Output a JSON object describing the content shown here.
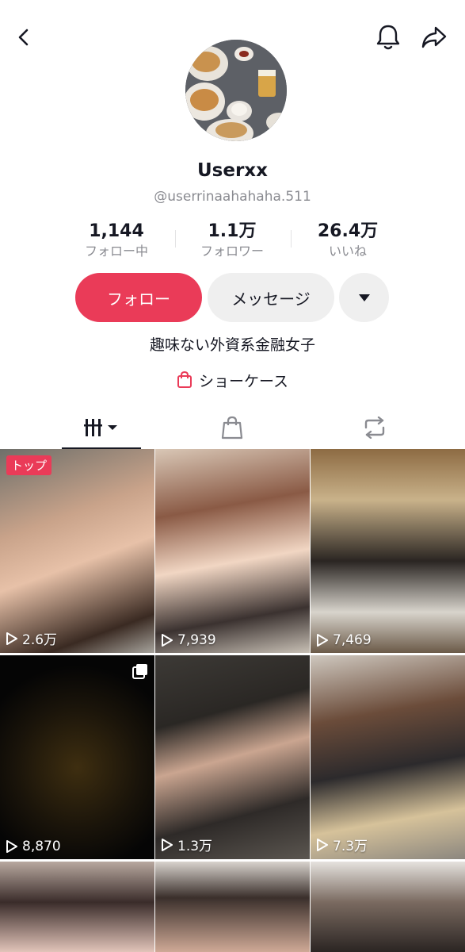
{
  "profile": {
    "username": "Userxx",
    "handle": "@userrinaahahaha.511",
    "bio": "趣味ない外資系金融女子"
  },
  "stats": [
    {
      "value": "1,144",
      "label": "フォロー中"
    },
    {
      "value": "1.1万",
      "label": "フォロワー"
    },
    {
      "value": "26.4万",
      "label": "いいね"
    }
  ],
  "actions": {
    "follow": "フォロー",
    "message": "メッセージ"
  },
  "showcase": {
    "label": "ショーケース"
  },
  "videos": [
    {
      "views": "2.6万",
      "badge": "トップ",
      "bg": "linear-gradient(160deg,#6e6f6a 0%,#c9a38a 35%,#e7c1a8 55%,#3a2a22 85%,#a7a49d 100%)"
    },
    {
      "views": "7,939",
      "bg": "linear-gradient(170deg,#d9c7b6 0%,#8a5a45 30%,#f1d6c3 55%,#3b3230 80%,#c8c0b5 100%)"
    },
    {
      "views": "7,469",
      "bg": "linear-gradient(180deg,#8d6b43 0%,#c9b28a 25%,#2a2522 55%,#d8d4cc 80%,#6b5a48 100%)"
    },
    {
      "views": "8,870",
      "multi": true,
      "bg": "radial-gradient(circle at 50% 55%,#3e2e10 0%,#1a140a 45%,#050505 75%),linear-gradient(180deg,#111 0%,#000 100%)"
    },
    {
      "views": "1.3万",
      "bg": "linear-gradient(165deg,#3d3a36 0%,#2a2724 30%,#caa590 50%,#2e2a28 75%,#5b5650 100%)"
    },
    {
      "views": "7.3万",
      "bg": "linear-gradient(170deg,#cfc8bf 0%,#6b4c3a 30%,#2c2a2c 55%,#d6c29a 78%,#8c877f 100%)"
    },
    {
      "views": "",
      "bg": "linear-gradient(180deg,#b8a89f 0%,#3a2c2a 45%,#e2c4b9 100%)"
    },
    {
      "views": "",
      "bg": "linear-gradient(180deg,#d8d3cd 0%,#3a2f2b 40%,#cfa996 100%)"
    },
    {
      "views": "",
      "bg": "linear-gradient(180deg,#e5e2de 0%,#7a6a60 45%,#2b2523 100%)"
    }
  ],
  "icons": {
    "back": "chevron-left-icon",
    "bell": "bell-icon",
    "share": "share-arrow-icon",
    "more": "triangle-down-icon",
    "bag": "shopping-bag-icon",
    "repost": "repost-icon",
    "grid": "video-grid-icon",
    "play": "play-icon"
  },
  "colors": {
    "accent": "#ea3b58",
    "text": "#161823",
    "muted": "#8a8b91",
    "button_bg": "#efefef"
  }
}
